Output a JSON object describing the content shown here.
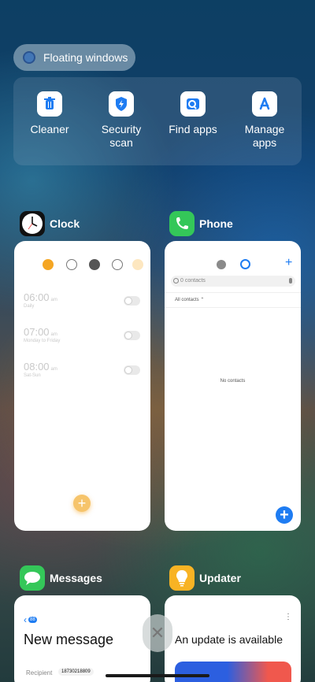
{
  "floating_windows": {
    "label": "Floating windows"
  },
  "quick_actions": [
    {
      "label": "Cleaner",
      "icon": "trash-icon"
    },
    {
      "label": "Security\nscan",
      "icon": "shield-bolt-icon"
    },
    {
      "label": "Find apps",
      "icon": "app-search-icon"
    },
    {
      "label": "Manage\napps",
      "icon": "app-store-icon"
    }
  ],
  "apps": {
    "clock": {
      "title": "Clock",
      "alarms": [
        {
          "time": "06:00",
          "ampm": "am",
          "repeat": "Daily"
        },
        {
          "time": "07:00",
          "ampm": "am",
          "repeat": "Monday to Friday"
        },
        {
          "time": "08:00",
          "ampm": "am",
          "repeat": "Sat-Sun"
        }
      ],
      "fab": "+"
    },
    "phone": {
      "title": "Phone",
      "search_placeholder": "0 contacts",
      "filter_label": "All contacts",
      "empty_text": "No contacts",
      "add_label": "+"
    },
    "messages": {
      "title": "Messages",
      "back_badge": "88",
      "heading": "New message",
      "recipient_label": "Recipient",
      "recipient_value": "18730218809"
    },
    "updater": {
      "title": "Updater",
      "headline": "An update is available"
    }
  },
  "colors": {
    "clock_accent": "#f5a623",
    "phone_green": "#34c759",
    "phone_blue": "#1e7cf2",
    "messages_green": "#34c759",
    "updater_yellow": "#f8b324"
  }
}
